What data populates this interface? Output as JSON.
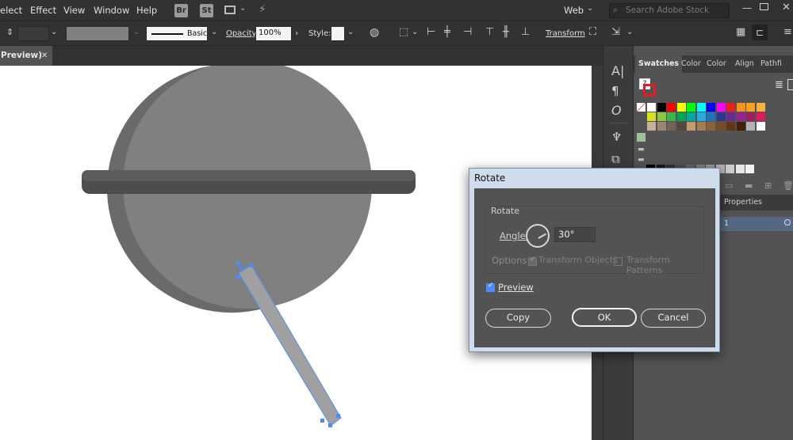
{
  "menubar": {
    "items": [
      "elect",
      "Effect",
      "View",
      "Window",
      "Help"
    ],
    "bridge_badge": "Br",
    "stock_badge": "St",
    "workspace": "Web",
    "search_placeholder": "Search Adobe Stock"
  },
  "controlbar": {
    "stroke_style": "Basic",
    "opacity_label": "Opacity:",
    "opacity_value": "100%",
    "style_label": "Style:",
    "transform_label": "Transform"
  },
  "document": {
    "tab_title": "Preview)",
    "close_symbol": "✕"
  },
  "panels": {
    "tabs": [
      "Swatches",
      "Color",
      "Color",
      "Align",
      "Pathfi"
    ],
    "layers_tab": "Properties",
    "layer_number": "1",
    "swatch_colors": [
      [
        "#ffffff",
        "#000000",
        "#ff0000",
        "#ffff00",
        "#00ff00",
        "#00ffff",
        "#0000ff",
        "#ff00ff",
        "#ed1c24",
        "#f7941d",
        "#f9a11b",
        "#fbb040"
      ],
      [
        "#d7df23",
        "#8dc63f",
        "#39b54a",
        "#00a651",
        "#00a99d",
        "#27aae1",
        "#1c75bc",
        "#2b3990",
        "#662d91",
        "#92278f",
        "#9e1f63",
        "#da1c5c"
      ],
      [
        "#c7b299",
        "#998675",
        "#736357",
        "#534741",
        "#c69c6d",
        "#a67c52",
        "#8c6239",
        "#754c24",
        "#603813",
        "#42210b",
        "#b3b3b3",
        "#ffffff"
      ],
      [
        "#000000",
        "#1a1a1a",
        "#333333",
        "#4d4d4d",
        "#666666",
        "#808080",
        "#999999",
        "#b3b3b3",
        "#cccccc",
        "#e6e6e6",
        "#f2f2f2"
      ],
      [
        "#27aae1",
        "#1c75bc",
        "#8dc63f",
        "#f7941d",
        "#ed1c24",
        "#ee2a7b",
        "#b3b3b3"
      ]
    ]
  },
  "dialog": {
    "title": "Rotate",
    "group_label": "Rotate",
    "angle_label": "Angle:",
    "angle_value": "30°",
    "options_label": "Options:",
    "transform_objects": "Transform Objects",
    "transform_patterns": "Transform Patterns",
    "preview_label": "Preview",
    "copy_button": "Copy",
    "ok_button": "OK",
    "cancel_button": "Cancel"
  },
  "colors": {
    "accent": "#4a8cff",
    "ui_dark": "#323232",
    "ui_mid": "#535353"
  }
}
